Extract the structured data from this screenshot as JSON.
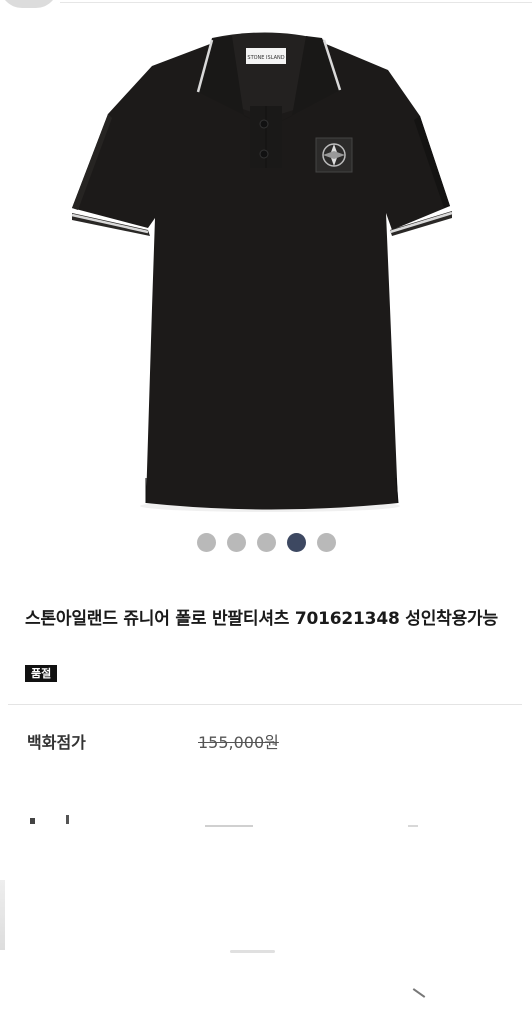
{
  "product": {
    "title": "스톤아일랜드 쥬니어 폴로 반팔티셔츠 701621348 성인착용가능",
    "status_badge": "품절",
    "collar_label_text": "STONE ISLAND"
  },
  "gallery": {
    "image_count": 5,
    "active_index": 3,
    "image_alt": "black polo shirt"
  },
  "price": {
    "label": "백화점가",
    "value": "155,000원"
  },
  "colors": {
    "shirt": "#1c1a19",
    "dot_inactive": "#b9b9b9",
    "dot_active": "#3d4861",
    "badge_bg": "#111111"
  }
}
